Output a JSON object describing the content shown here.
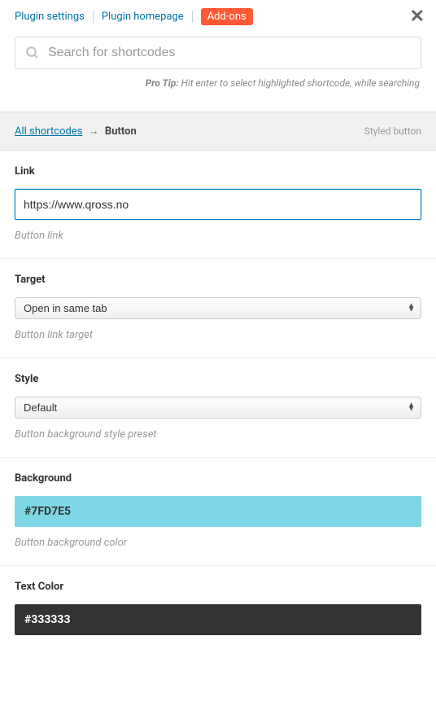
{
  "nav": {
    "settings": "Plugin settings",
    "homepage": "Plugin homepage",
    "addons": "Add-ons"
  },
  "search": {
    "placeholder": "Search for shortcodes"
  },
  "protip": {
    "label": "Pro Tip:",
    "text": " Hit enter to select highlighted shortcode, while searching"
  },
  "breadcrumb": {
    "root": "All shortcodes",
    "current": "Button",
    "label": "Styled button"
  },
  "fields": {
    "link": {
      "label": "Link",
      "value": "https://www.qross.no",
      "help": "Button link"
    },
    "target": {
      "label": "Target",
      "value": "Open in same tab",
      "help": "Button link target"
    },
    "style": {
      "label": "Style",
      "value": "Default",
      "help": "Button background style preset"
    },
    "background": {
      "label": "Background",
      "value": "#7FD7E5",
      "help": "Button background color"
    },
    "textcolor": {
      "label": "Text Color",
      "value": "#333333"
    }
  }
}
